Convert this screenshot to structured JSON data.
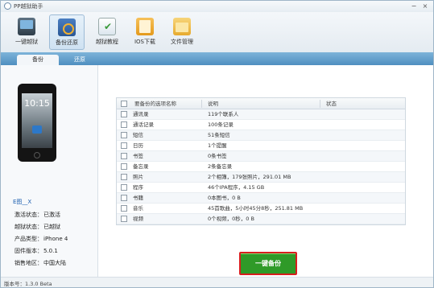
{
  "window": {
    "title": "PP越狱助手",
    "minimize_glyph": "−",
    "close_glyph": "×"
  },
  "toolbar": {
    "items": [
      {
        "label": "一键越狱",
        "icon": "phone-jailbreak-icon"
      },
      {
        "label": "备份还原",
        "icon": "backup-restore-icon"
      },
      {
        "label": "越狱教程",
        "icon": "checklist-icon"
      },
      {
        "label": "IOS下载",
        "icon": "download-icon"
      },
      {
        "label": "文件管理",
        "icon": "folder-icon"
      }
    ],
    "active_index": 1
  },
  "tabs": [
    {
      "label": "备份",
      "active": true
    },
    {
      "label": "还原",
      "active": false
    }
  ],
  "device": {
    "lock_time": "10:15",
    "name": "E图__X",
    "info": [
      {
        "key": "激活状态：",
        "value": "已激活"
      },
      {
        "key": "越狱状态：",
        "value": "已越狱"
      },
      {
        "key": "产品类型：",
        "value": "iPhone 4"
      },
      {
        "key": "固件版本：",
        "value": "5.0.1"
      },
      {
        "key": "销售地区：",
        "value": "中国大陆"
      }
    ]
  },
  "table": {
    "columns": {
      "name": "要备份的选项名称",
      "desc": "说明",
      "status": "状态"
    },
    "rows": [
      {
        "name": "通讯录",
        "desc": "119个联系人"
      },
      {
        "name": "通话记录",
        "desc": "100条记录"
      },
      {
        "name": "短信",
        "desc": "51条短信"
      },
      {
        "name": "日历",
        "desc": "1个提醒"
      },
      {
        "name": "书签",
        "desc": "0条书签"
      },
      {
        "name": "备忘录",
        "desc": "2条备忘录"
      },
      {
        "name": "照片",
        "desc": "2个相簿，179张照片，291.01 MB"
      },
      {
        "name": "程序",
        "desc": "46个IPA程序，4.15 GB"
      },
      {
        "name": "书籍",
        "desc": "0本图书，0 B"
      },
      {
        "name": "音乐",
        "desc": "45首歌曲，5小时45分8秒，251.81 MB"
      },
      {
        "name": "视频",
        "desc": "0个视频，0秒，0 B"
      }
    ]
  },
  "actions": {
    "backup_button": "一键备份"
  },
  "status": {
    "version": "版本号：1.3.0 Beta"
  },
  "colors": {
    "accent_blue": "#5d9cd0",
    "button_green": "#2f9a28",
    "highlight_red": "#d71e1e"
  }
}
